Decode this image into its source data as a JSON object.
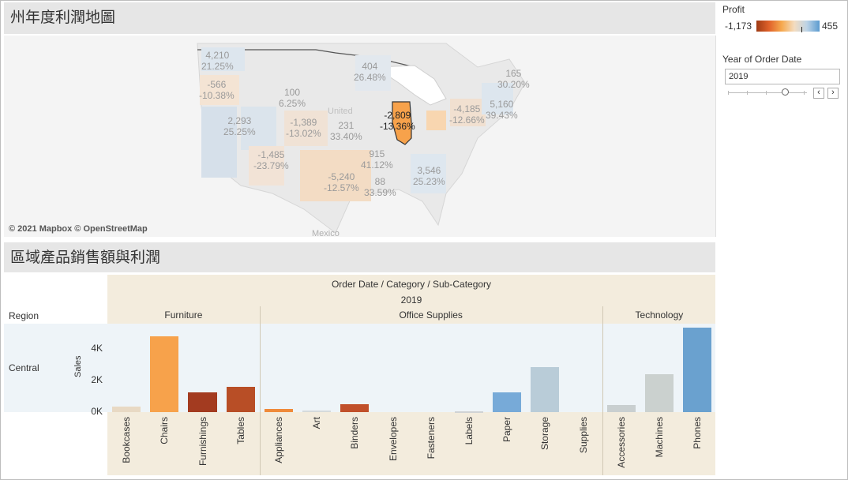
{
  "map": {
    "title": "州年度利潤地圖",
    "copyright": "© 2021 Mapbox © OpenStreetMap",
    "country_label": "United",
    "mexico_label": "Mexico",
    "states": [
      {
        "id": "wa",
        "profit": "4,210",
        "pct": "21.25%"
      },
      {
        "id": "or",
        "profit": "-566",
        "pct": "-10.38%"
      },
      {
        "id": "mt",
        "profit": "100",
        "pct": "6.25%"
      },
      {
        "id": "mn",
        "profit": "404",
        "pct": "26.48%"
      },
      {
        "id": "ut",
        "profit": "2,293",
        "pct": "25.25%"
      },
      {
        "id": "co",
        "profit": "-1,389",
        "pct": "-13.02%"
      },
      {
        "id": "ne",
        "profit": "231",
        "pct": "33.40%"
      },
      {
        "id": "az",
        "profit": "-1,485",
        "pct": "-23.79%"
      },
      {
        "id": "tx",
        "profit": "-5,240",
        "pct": "-12.57%"
      },
      {
        "id": "il",
        "profit": "-2,809",
        "pct": "-13.36%"
      },
      {
        "id": "tn",
        "profit": "915",
        "pct": "41.12%"
      },
      {
        "id": "ms",
        "profit": "88",
        "pct": "33.59%"
      },
      {
        "id": "ga",
        "profit": "3,546",
        "pct": "25.23%"
      },
      {
        "id": "pa",
        "profit": "-4,185",
        "pct": "-12.66%"
      },
      {
        "id": "ny",
        "profit": "5,160",
        "pct": "39.43%"
      },
      {
        "id": "ma",
        "profit": "165",
        "pct": "30.20%"
      }
    ]
  },
  "legend": {
    "title": "Profit",
    "min": "-1,173",
    "max": "455",
    "colors": {
      "neg": "#9e3a14",
      "mid": "#f6a94e",
      "pos": "#5b9bd0"
    }
  },
  "filter": {
    "title": "Year of Order Date",
    "value": "2019",
    "prev_icon": "chevron-left-icon",
    "next_icon": "chevron-right-icon",
    "prev_glyph": "‹",
    "next_glyph": "›"
  },
  "chart": {
    "title": "區域產品銷售額與利潤",
    "header_path": "Order Date  /  Category  /  Sub-Category",
    "year": "2019",
    "region_header": "Region",
    "region": "Central",
    "measure": "Sales"
  },
  "chart_data": {
    "type": "bar",
    "title": "區域產品銷售額與利潤",
    "ylabel": "Sales",
    "ylim": [
      0,
      5500
    ],
    "yticks": [
      {
        "v": 0,
        "label": "0K"
      },
      {
        "v": 2000,
        "label": "2K"
      },
      {
        "v": 4000,
        "label": "4K"
      }
    ],
    "grid": false,
    "categories": [
      {
        "name": "Furniture",
        "subs": [
          {
            "name": "Bookcases",
            "value": 330,
            "color": "#e8d9c4"
          },
          {
            "name": "Chairs",
            "value": 4800,
            "color": "#f7a24b"
          },
          {
            "name": "Furnishings",
            "value": 1240,
            "color": "#a33b20"
          },
          {
            "name": "Tables",
            "value": 1600,
            "color": "#b84e26"
          }
        ]
      },
      {
        "name": "Office Supplies",
        "subs": [
          {
            "name": "Appliances",
            "value": 200,
            "color": "#ef8a3a"
          },
          {
            "name": "Art",
            "value": 90,
            "color": "#d5dadb"
          },
          {
            "name": "Binders",
            "value": 520,
            "color": "#c1502a"
          },
          {
            "name": "Envelopes",
            "value": 0,
            "color": "#dddddd"
          },
          {
            "name": "Fasteners",
            "value": 0,
            "color": "#dddddd"
          },
          {
            "name": "Labels",
            "value": 40,
            "color": "#d0d3d4"
          },
          {
            "name": "Paper",
            "value": 1230,
            "color": "#77aad8"
          },
          {
            "name": "Storage",
            "value": 2850,
            "color": "#b9ccd8"
          },
          {
            "name": "Supplies",
            "value": 0,
            "color": "#dddddd"
          }
        ]
      },
      {
        "name": "Technology",
        "subs": [
          {
            "name": "Accessories",
            "value": 460,
            "color": "#c9cfd0"
          },
          {
            "name": "Machines",
            "value": 2400,
            "color": "#cbd1cf"
          },
          {
            "name": "Phones",
            "value": 5350,
            "color": "#6aa1cf"
          }
        ]
      }
    ]
  }
}
